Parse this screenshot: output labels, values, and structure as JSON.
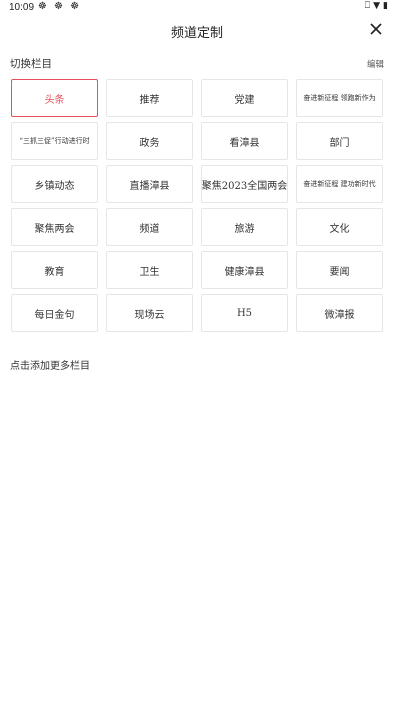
{
  "status_bar": {
    "time": "10:09",
    "notification_icons": "☸ ☸ ☸",
    "vibrate_icon": "⎕",
    "wifi_icon": "▼",
    "battery_icon": "▮"
  },
  "header": {
    "title": "频道定制"
  },
  "section": {
    "title": "切换栏目",
    "edit_label": "编辑"
  },
  "channels": [
    {
      "label": "头条",
      "active": true
    },
    {
      "label": "推荐"
    },
    {
      "label": "党建"
    },
    {
      "label": "奋进新征程  领跑新作为",
      "small": true
    },
    {
      "label": "“三抓三促”行动进行时",
      "small": true
    },
    {
      "label": "政务"
    },
    {
      "label": "看漳县"
    },
    {
      "label": "部门"
    },
    {
      "label": "乡镇动态"
    },
    {
      "label": "直播漳县"
    },
    {
      "label": "聚焦2023全国两会"
    },
    {
      "label": "奋进新征程  建功新时代",
      "small": true
    },
    {
      "label": "聚焦两会"
    },
    {
      "label": "频道"
    },
    {
      "label": "旅游"
    },
    {
      "label": "文化"
    },
    {
      "label": "教育"
    },
    {
      "label": "卫生"
    },
    {
      "label": "健康漳县"
    },
    {
      "label": "要闻"
    },
    {
      "label": "每日金句"
    },
    {
      "label": "现场云"
    },
    {
      "label": "H5"
    },
    {
      "label": "微漳报"
    }
  ],
  "add_more_label": "点击添加更多栏目",
  "colors": {
    "accent": "#e8505b",
    "tile_border": "#e6e6e6",
    "text": "#333333"
  }
}
